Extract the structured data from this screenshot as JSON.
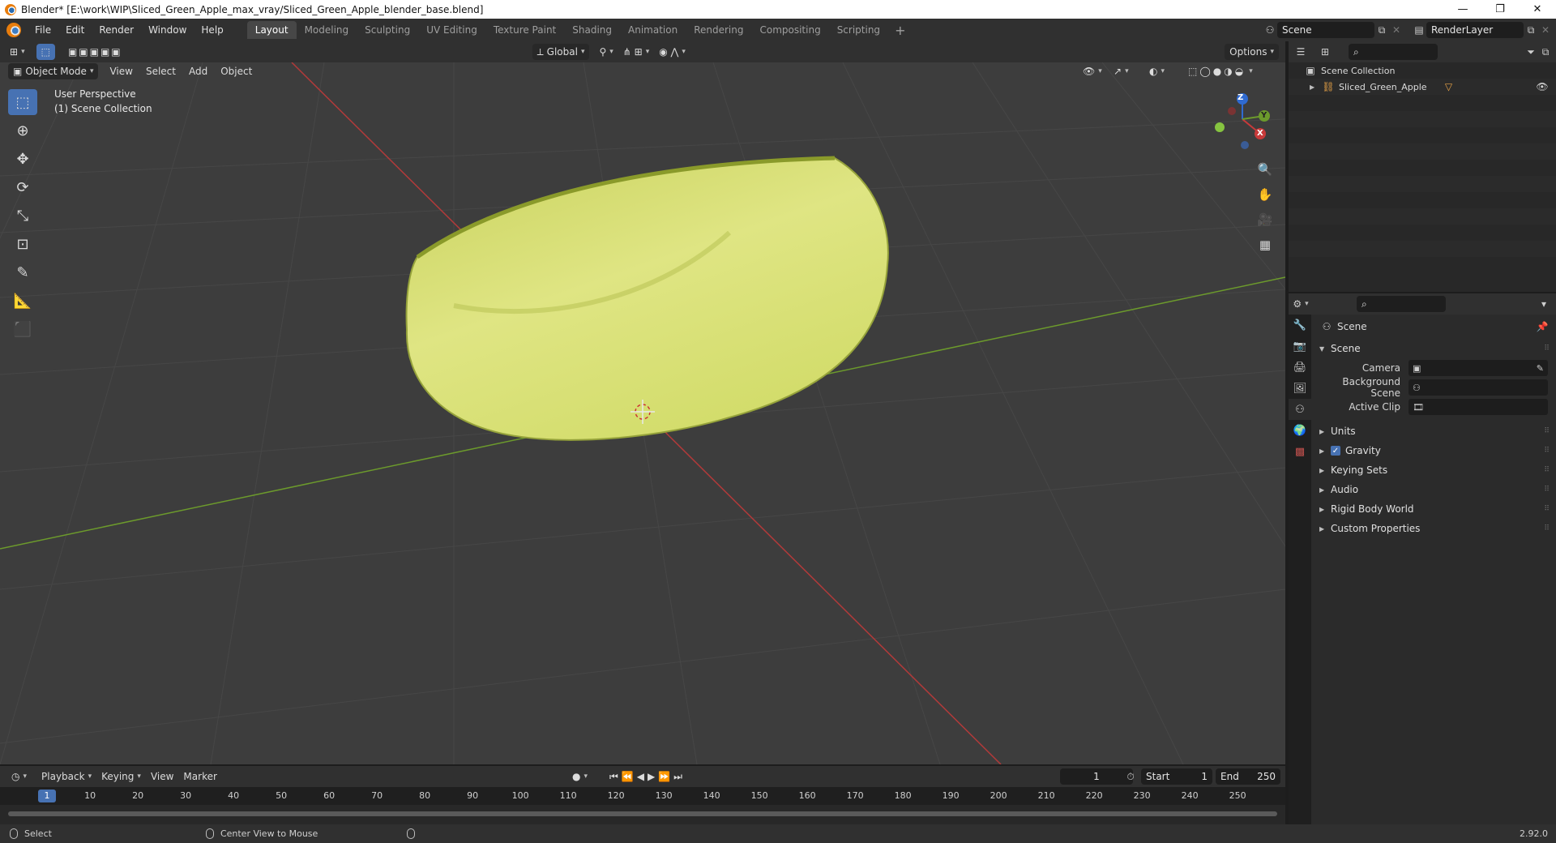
{
  "window": {
    "title": "Blender* [E:\\work\\WIP\\Sliced_Green_Apple_max_vray/Sliced_Green_Apple_blender_base.blend]",
    "controls": [
      "—",
      "❐",
      "✕"
    ]
  },
  "menu": [
    "File",
    "Edit",
    "Render",
    "Window",
    "Help"
  ],
  "workspaces": [
    {
      "label": "Layout",
      "active": true
    },
    {
      "label": "Modeling"
    },
    {
      "label": "Sculpting"
    },
    {
      "label": "UV Editing"
    },
    {
      "label": "Texture Paint"
    },
    {
      "label": "Shading"
    },
    {
      "label": "Animation"
    },
    {
      "label": "Rendering"
    },
    {
      "label": "Compositing"
    },
    {
      "label": "Scripting"
    }
  ],
  "top_right": {
    "scene": "Scene",
    "view_layer": "RenderLayer"
  },
  "viewport_header": {
    "transform_orientation": "Global",
    "options": "Options",
    "mode": "Object Mode",
    "menus": [
      "View",
      "Select",
      "Add",
      "Object"
    ]
  },
  "viewport": {
    "perspective": "User Perspective",
    "collection": "(1) Scene Collection",
    "gizmo": {
      "x": "X",
      "y": "Y",
      "z": "Z"
    }
  },
  "outliner": {
    "root": "Scene Collection",
    "items": [
      "Sliced_Green_Apple"
    ]
  },
  "properties": {
    "context": "Scene",
    "panel": "Scene",
    "fields": [
      {
        "label": "Camera",
        "value": ""
      },
      {
        "label": "Background Scene",
        "value": ""
      },
      {
        "label": "Active Clip",
        "value": ""
      }
    ],
    "subpanels": [
      "Units",
      "Gravity",
      "Keying Sets",
      "Audio",
      "Rigid Body World",
      "Custom Properties"
    ]
  },
  "timeline": {
    "menus": [
      "Playback",
      "Keying",
      "View",
      "Marker"
    ],
    "current_frame": "1",
    "start_label": "Start",
    "start": "1",
    "end_label": "End",
    "end": "250",
    "ruler": [
      "1",
      "10",
      "20",
      "30",
      "40",
      "50",
      "60",
      "70",
      "80",
      "90",
      "100",
      "110",
      "120",
      "130",
      "140",
      "150",
      "160",
      "170",
      "180",
      "190",
      "200",
      "210",
      "220",
      "230",
      "240",
      "250"
    ]
  },
  "statusbar": {
    "select": "Select",
    "center": "Center View to Mouse",
    "version": "2.92.0"
  },
  "colors": {
    "accent": "#4772b3",
    "x_axis": "#c83a3a",
    "y_axis": "#6c9a2c",
    "apple": "#d8e07a"
  }
}
